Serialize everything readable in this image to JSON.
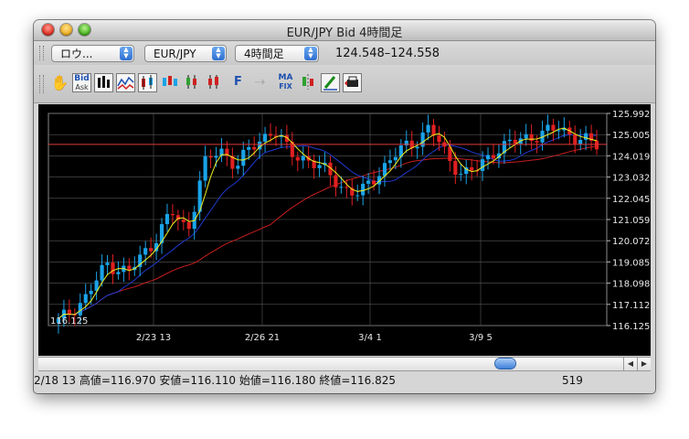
{
  "window": {
    "title": "EUR/JPY Bid 4時間足"
  },
  "toolbar": {
    "drawing_select": "ロウ...",
    "pair_select": "EUR/JPY",
    "timeframe_select": "4時間足",
    "quote": "124.548–124.558"
  },
  "tools": {
    "bid_top": "Bid",
    "bid_bottom": "Ask",
    "fix_label": "F",
    "ma_fix_top": "MA",
    "ma_fix_bottom": "FIX"
  },
  "colors": {
    "candle_up": "#1aa3e8",
    "candle_down": "#e02020",
    "ma_fast": "#f0f020",
    "ma_mid": "#1f3ad0",
    "ma_slow": "#c81e1e",
    "price_line": "#e23a3a"
  },
  "chart_data": {
    "type": "candlestick",
    "y_axis_ticks": [
      "125.992",
      "125.005",
      "124.019",
      "123.032",
      "122.045",
      "121.059",
      "120.072",
      "119.085",
      "118.098",
      "117.112",
      "116.125"
    ],
    "ylim": [
      116.125,
      125.992
    ],
    "x_axis_ticks": [
      "2/23 13",
      "2/26 21",
      "3/4 1",
      "3/9 5"
    ],
    "min_label": "116.125",
    "current_price": 124.55,
    "grid": true
  },
  "status": {
    "left": "2/18 13  高値=116.970 安値=116.110 始値=116.180 終値=116.825",
    "right": "519"
  }
}
